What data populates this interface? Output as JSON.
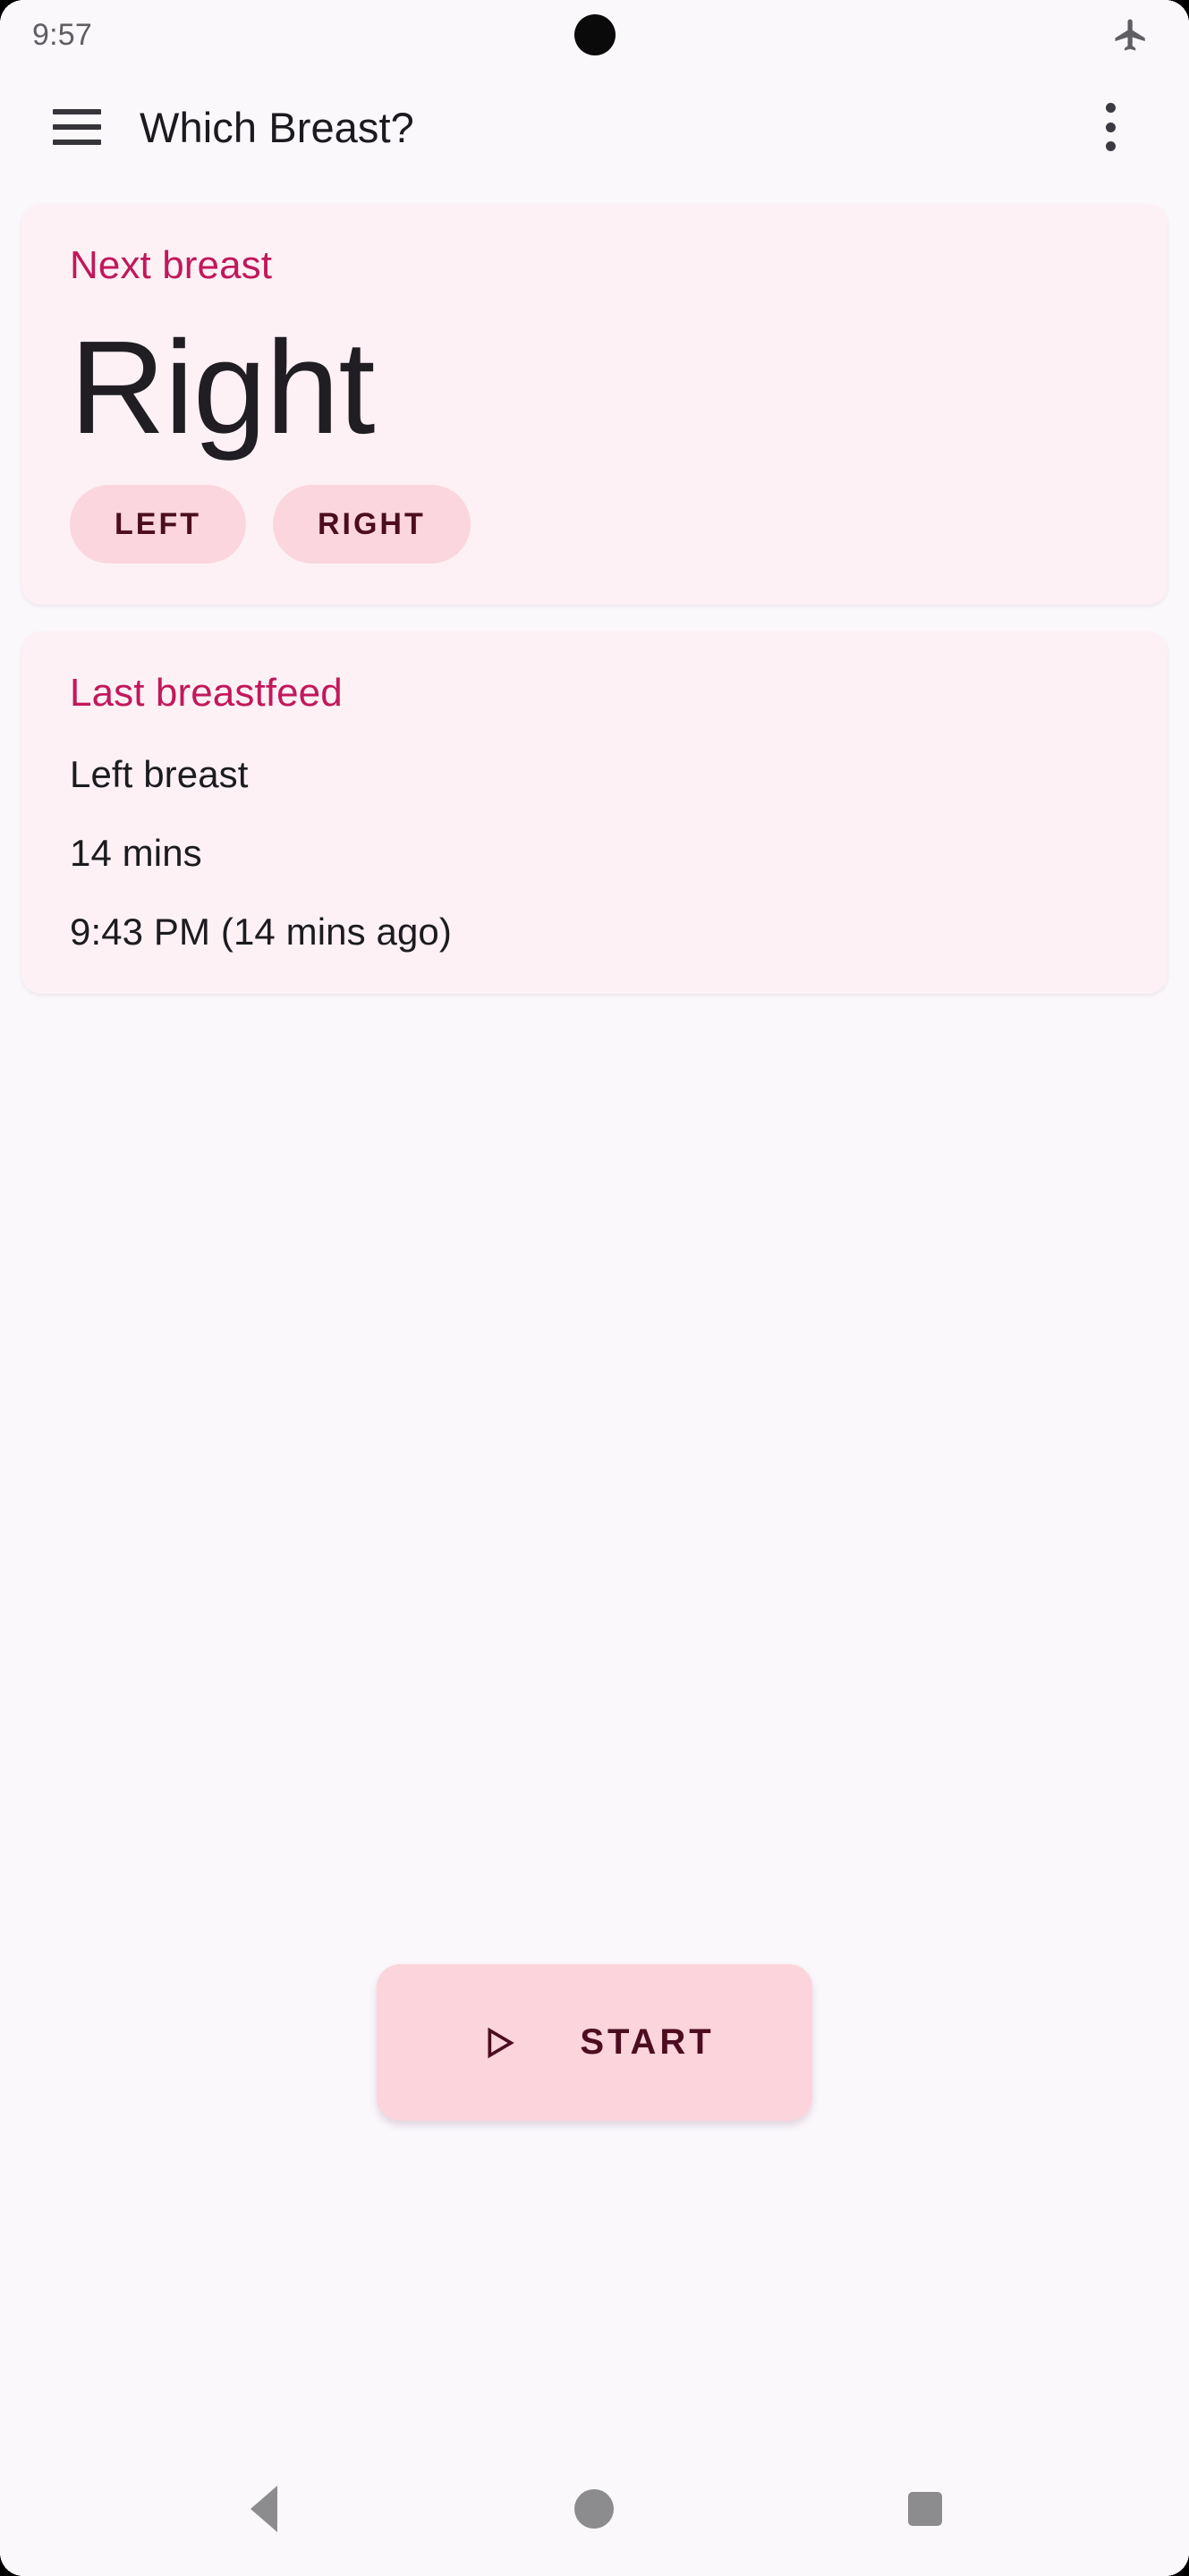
{
  "status_bar": {
    "time": "9:57",
    "airplane_icon": "airplane-mode-icon",
    "camera": "punch-hole-camera"
  },
  "app_bar": {
    "menu_icon": "hamburger-menu-icon",
    "title": "Which Breast?",
    "overflow_icon": "more-vert-icon"
  },
  "next_breast_card": {
    "title": "Next breast",
    "value": "Right",
    "chips": [
      {
        "label": "LEFT"
      },
      {
        "label": "RIGHT"
      }
    ]
  },
  "last_breastfeed_card": {
    "title": "Last breastfeed",
    "side": "Left breast",
    "duration": "14 mins",
    "time": "9:43 PM (14 mins ago)"
  },
  "start_button": {
    "label": "START",
    "icon": "play-arrow-icon"
  },
  "nav_bar": {
    "back": "back-icon",
    "home": "home-icon",
    "recents": "recents-icon"
  },
  "colors": {
    "page_background": "#FBF8FC",
    "card_background": "#FDF1F6",
    "accent_pink": "#C2185B",
    "chip_background": "#FBD6DE",
    "chip_text": "#4C0D20",
    "button_background": "#FCD4DC",
    "text_primary": "#1C1B1F"
  }
}
